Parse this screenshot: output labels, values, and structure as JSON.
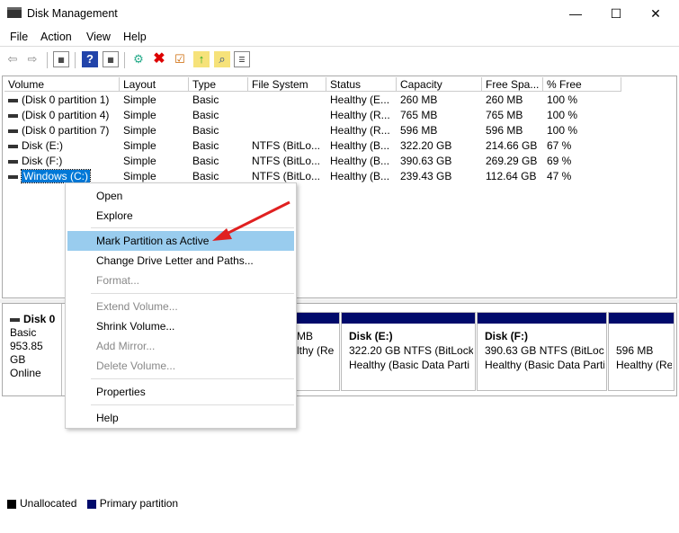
{
  "window": {
    "title": "Disk Management",
    "app_icon": "disk-management-icon",
    "controls": [
      "minimize-icon",
      "maximize-icon",
      "close-icon"
    ]
  },
  "menu": [
    "File",
    "Action",
    "View",
    "Help"
  ],
  "toolbar": [
    "back-icon",
    "forward-icon",
    "show-hide-console-tree-icon",
    "help-icon",
    "show-hide-action-pane-icon",
    "connect-icon",
    "delete-icon",
    "properties-icon",
    "up-folder-icon",
    "find-icon",
    "details-icon"
  ],
  "columns": [
    "Volume",
    "Layout",
    "Type",
    "File System",
    "Status",
    "Capacity",
    "Free Spa...",
    "% Free"
  ],
  "rows": [
    [
      "(Disk 0 partition 1)",
      "Simple",
      "Basic",
      "",
      "Healthy (E...",
      "260 MB",
      "260 MB",
      "100 %"
    ],
    [
      "(Disk 0 partition 4)",
      "Simple",
      "Basic",
      "",
      "Healthy (R...",
      "765 MB",
      "765 MB",
      "100 %"
    ],
    [
      "(Disk 0 partition 7)",
      "Simple",
      "Basic",
      "",
      "Healthy (R...",
      "596 MB",
      "596 MB",
      "100 %"
    ],
    [
      "Disk (E:)",
      "Simple",
      "Basic",
      "NTFS (BitLo...",
      "Healthy (B...",
      "322.20 GB",
      "214.66 GB",
      "67 %"
    ],
    [
      "Disk (F:)",
      "Simple",
      "Basic",
      "NTFS (BitLo...",
      "Healthy (B...",
      "390.63 GB",
      "269.29 GB",
      "69 %"
    ],
    [
      "Windows (C:)",
      "Simple",
      "Basic",
      "NTFS (BitLo...",
      "Healthy (B...",
      "239.43 GB",
      "112.64 GB",
      "47 %"
    ]
  ],
  "disk": {
    "name": "Disk 0",
    "type": "Basic",
    "size": "953.85 GB",
    "status": "Online"
  },
  "partitions": [
    {
      "title": "",
      "line1": "MB",
      "line2": "lthy (Re"
    },
    {
      "title": "Disk  (E:)",
      "line1": "322.20 GB NTFS (BitLock",
      "line2": "Healthy (Basic Data Parti"
    },
    {
      "title": "Disk  (F:)",
      "line1": "390.63 GB NTFS (BitLocke",
      "line2": "Healthy (Basic Data Partit"
    },
    {
      "title": "",
      "line1": "596 MB",
      "line2": "Healthy (Re"
    }
  ],
  "legend": [
    {
      "label": "Unallocated",
      "color": "#000000"
    },
    {
      "label": "Primary partition",
      "color": "#000a6b"
    }
  ],
  "context_menu": [
    {
      "label": "Open",
      "enabled": true
    },
    {
      "label": "Explore",
      "enabled": true
    },
    {
      "label": "Mark Partition as Active",
      "enabled": true,
      "highlighted": true
    },
    {
      "label": "Change Drive Letter and Paths...",
      "enabled": true
    },
    {
      "label": "Format...",
      "enabled": false
    },
    {
      "label": "Extend Volume...",
      "enabled": false
    },
    {
      "label": "Shrink Volume...",
      "enabled": true
    },
    {
      "label": "Add Mirror...",
      "enabled": false
    },
    {
      "label": "Delete Volume...",
      "enabled": false
    },
    {
      "label": "Properties",
      "enabled": true
    },
    {
      "label": "Help",
      "enabled": true
    }
  ],
  "colors": {
    "selection": "#0078d7",
    "highlight": "#99ccee",
    "primary_partition": "#000a6b",
    "annotation_arrow": "#e02020"
  }
}
